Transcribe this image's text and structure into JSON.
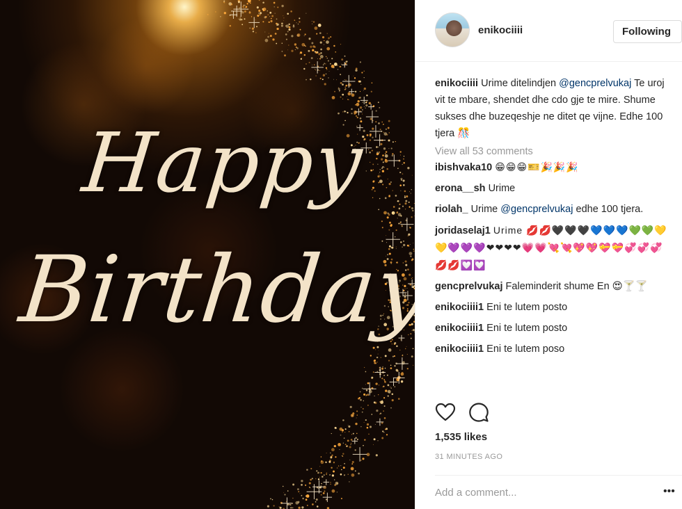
{
  "photo": {
    "line1": "Happy",
    "line2": "Birthday"
  },
  "header": {
    "username": "enikociiii",
    "follow_label": "Following"
  },
  "caption": {
    "user": "enikociiii",
    "text_before": "Urime ditelindjen ",
    "mention": "@gencprelvukaj",
    "text_after": " Te uroj vit te mbare, shendet dhe cdo gje te mire. Shume sukses dhe buzeqeshje ne ditet qe vijne. Edhe 100 tjera 🎊"
  },
  "view_all": "View all 53 comments",
  "comments": [
    {
      "user": "ibishvaka10",
      "text": "😁😁😁🎫🎉🎉🎉"
    },
    {
      "user": "erona__sh",
      "text": "Urime"
    },
    {
      "user": "riolah_",
      "text_before": "Urime ",
      "mention": "@gencprelvukaj",
      "text_after": " edhe 100 tjera."
    },
    {
      "user": "joridaselaj1",
      "text": "Urime 💋💋🖤🖤🖤💙💙💙💚💚💛💛💜💜💜❤❤❤❤💗💗💘💘💖💖💝💝💞💞💞💋💋💟💟"
    },
    {
      "user": "gencprelvukaj",
      "text": "Faleminderit shume En 😍🍸🍸"
    },
    {
      "user": "enikociiii1",
      "text": "Eni te lutem posto"
    },
    {
      "user": "enikociiii1",
      "text": "Eni te lutem posto"
    },
    {
      "user": "enikociiii1",
      "text": "Eni te lutem poso"
    }
  ],
  "likes": "1,535 likes",
  "time": "31 MINUTES AGO",
  "add_comment_placeholder": "Add a comment...",
  "more_label": "•••",
  "icons": {
    "like": "heart-icon",
    "comment": "comment-bubble-icon",
    "more": "more-options-icon"
  },
  "colors": {
    "mention": "#003569",
    "muted": "#999999",
    "text": "#262626"
  }
}
